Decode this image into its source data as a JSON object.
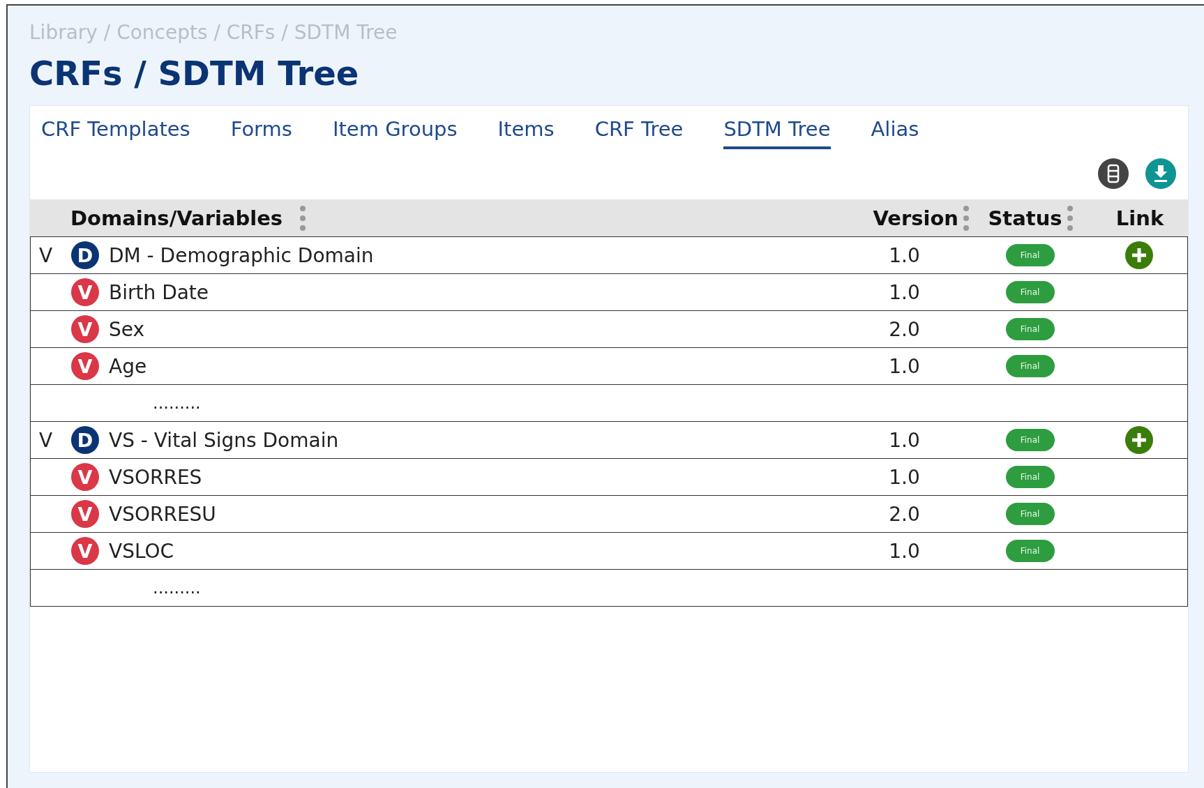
{
  "breadcrumb": "Library / Concepts / CRFs / SDTM Tree",
  "title": "CRFs / SDTM Tree",
  "tabs": [
    {
      "label": "CRF Templates",
      "selected": false
    },
    {
      "label": "Forms",
      "selected": false
    },
    {
      "label": "Item Groups",
      "selected": false
    },
    {
      "label": "Items",
      "selected": false
    },
    {
      "label": "CRF Tree",
      "selected": false
    },
    {
      "label": "SDTM Tree",
      "selected": true
    },
    {
      "label": "Alias",
      "selected": false
    }
  ],
  "table": {
    "columns": [
      {
        "label": "Domains/Variables",
        "menu": true
      },
      {
        "label": "Version",
        "menu": true
      },
      {
        "label": "Status",
        "menu": true
      },
      {
        "label": "Link",
        "menu": false
      }
    ],
    "rows": [
      {
        "toggle": "V",
        "badge": "D",
        "name": "DM - Demographic Domain",
        "version": "1.0",
        "status": "Final",
        "link": true,
        "children": [
          {
            "kind": "variable",
            "badge": "V",
            "name": "Birth Date",
            "version": "1.0",
            "status": "Final"
          },
          {
            "kind": "variable",
            "badge": "V",
            "name": "Sex",
            "version": "2.0",
            "status": "Final"
          },
          {
            "kind": "variable",
            "badge": "V",
            "name": "Age",
            "version": "1.0",
            "status": "Final"
          },
          {
            "kind": "more",
            "text": "........."
          }
        ]
      },
      {
        "toggle": "V",
        "badge": "D",
        "name": "VS - Vital Signs Domain",
        "version": "1.0",
        "status": "Final",
        "link": true,
        "children": [
          {
            "kind": "variable",
            "badge": "V",
            "name": "VSORRES",
            "version": "1.0",
            "status": "Final"
          },
          {
            "kind": "variable",
            "badge": "V",
            "name": "VSORRESU",
            "version": "2.0",
            "status": "Final"
          },
          {
            "kind": "variable",
            "badge": "V",
            "name": "VSLOC",
            "version": "1.0",
            "status": "Final"
          },
          {
            "kind": "more",
            "text": "........."
          }
        ]
      }
    ]
  }
}
